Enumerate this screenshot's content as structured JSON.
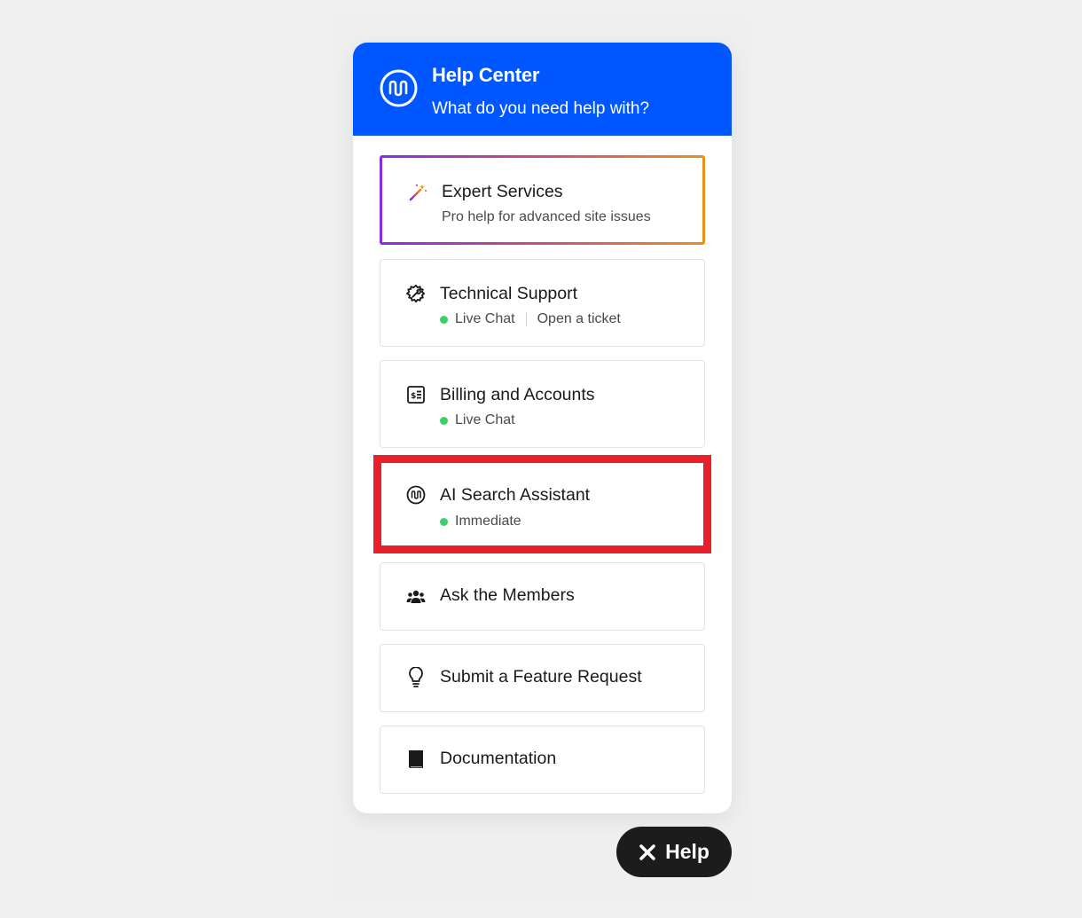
{
  "header": {
    "title": "Help Center",
    "subtitle": "What do you need help with?",
    "logo_icon": "brand-wave-logo"
  },
  "items": [
    {
      "icon": "magic-wand-icon",
      "title": "Expert Services",
      "description": "Pro help for advanced site issues",
      "style": "gradient-border"
    },
    {
      "icon": "gear-wrench-icon",
      "title": "Technical Support",
      "status": "Live Chat",
      "secondary_link": "Open a ticket"
    },
    {
      "icon": "billing-icon",
      "title": "Billing and Accounts",
      "status": "Live Chat"
    },
    {
      "icon": "ai-logo-icon",
      "title": "AI Search Assistant",
      "status": "Immediate",
      "highlighted": true
    },
    {
      "icon": "members-icon",
      "title": "Ask the Members"
    },
    {
      "icon": "lightbulb-icon",
      "title": "Submit a Feature Request"
    },
    {
      "icon": "book-icon",
      "title": "Documentation"
    }
  ],
  "help_button": {
    "label": "Help",
    "icon": "close-icon"
  },
  "colors": {
    "header_bg": "#0057ff",
    "status_dot": "#3ccf6a",
    "highlight": "#e8202a",
    "help_button_bg": "#1c1c1c",
    "gradient": [
      "#8a2be2",
      "#e8921a"
    ]
  }
}
